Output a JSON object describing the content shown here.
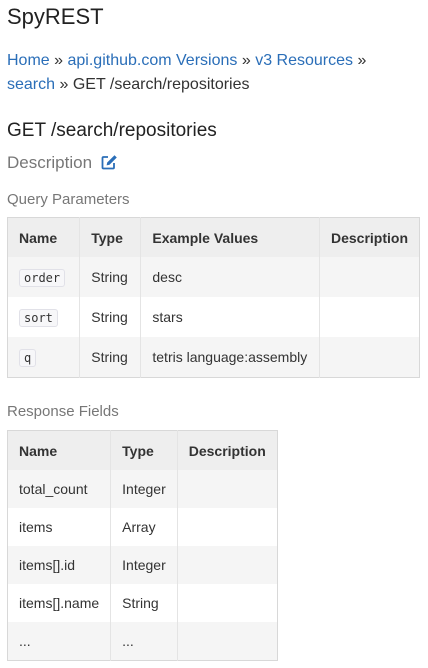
{
  "site": {
    "title": "SpyREST"
  },
  "breadcrumb": {
    "items": [
      {
        "label": "Home"
      },
      {
        "label": "api.github.com Versions"
      },
      {
        "label": "v3 Resources"
      },
      {
        "label": "search"
      }
    ],
    "separator": "»",
    "current": "GET /search/repositories"
  },
  "page": {
    "heading": "GET /search/repositories",
    "description_label": "Description",
    "edit_icon": "edit-icon",
    "accent_color": "#2a6eb8"
  },
  "query_params": {
    "title": "Query Parameters",
    "headers": [
      "Name",
      "Type",
      "Example Values",
      "Description"
    ],
    "rows": [
      {
        "name": "order",
        "type": "String",
        "example": "desc",
        "description": ""
      },
      {
        "name": "sort",
        "type": "String",
        "example": "stars",
        "description": ""
      },
      {
        "name": "q",
        "type": "String",
        "example": "tetris language:assembly",
        "description": ""
      }
    ]
  },
  "response_fields": {
    "title": "Response Fields",
    "headers": [
      "Name",
      "Type",
      "Description"
    ],
    "rows": [
      {
        "name": "total_count",
        "type": "Integer",
        "description": ""
      },
      {
        "name": "items",
        "type": "Array",
        "description": ""
      },
      {
        "name": "items[].id",
        "type": "Integer",
        "description": ""
      },
      {
        "name": "items[].name",
        "type": "String",
        "description": ""
      },
      {
        "name": "...",
        "type": "...",
        "description": ""
      }
    ]
  }
}
